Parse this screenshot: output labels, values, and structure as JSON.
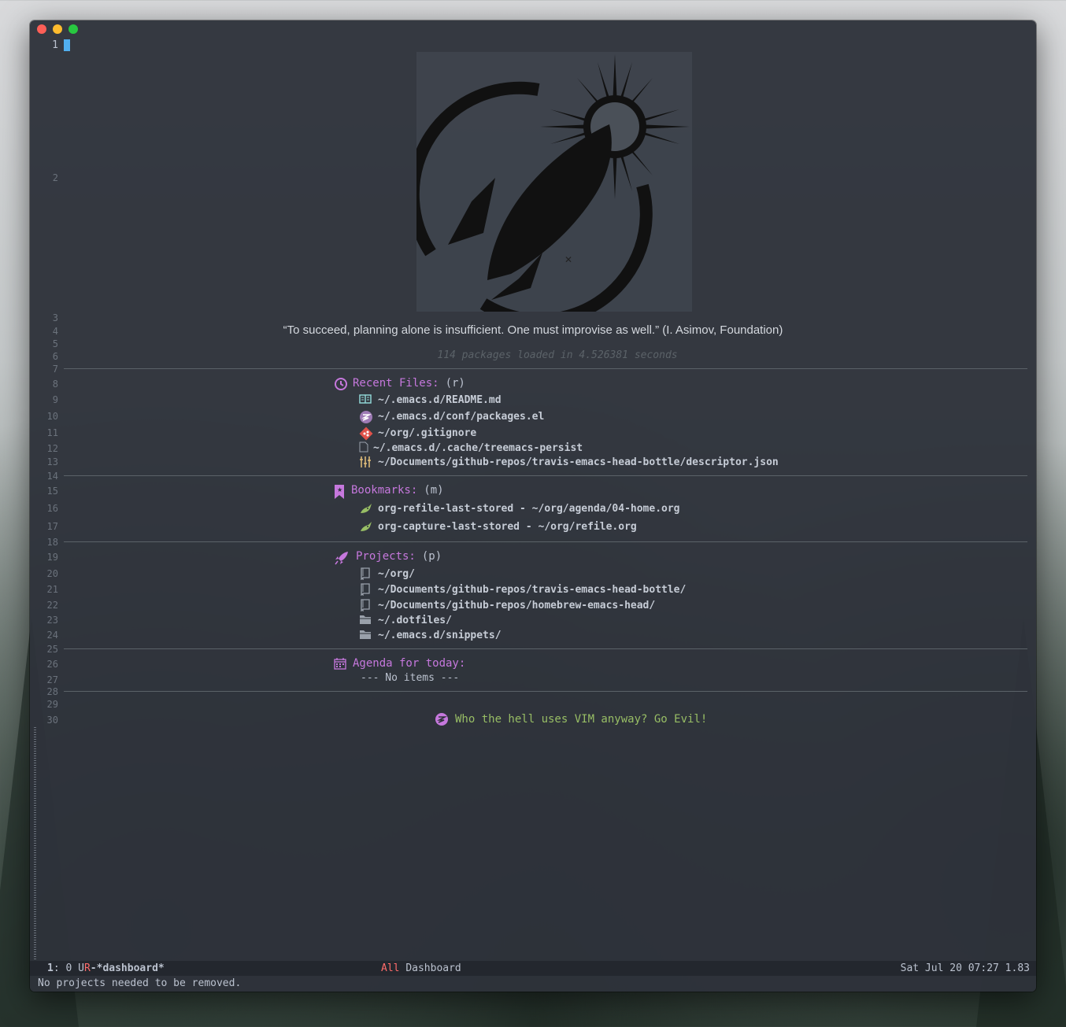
{
  "line_numbers": [
    "1",
    "2",
    "3",
    "4",
    "5",
    "6",
    "7",
    "8",
    "9",
    "10",
    "11",
    "12",
    "13",
    "14",
    "15",
    "16",
    "17",
    "18",
    "19",
    "20",
    "21",
    "22",
    "23",
    "24",
    "25",
    "26",
    "27",
    "28",
    "29",
    "30"
  ],
  "quote": "“To succeed, planning alone is insufficient. One must improvise as well.”  (I. Asimov, Foundation)",
  "loaded_text": "114 packages loaded in 4.526381 seconds",
  "recent_files": {
    "title": "Recent Files:",
    "key": "(r)",
    "icon": "history-icon",
    "items": [
      {
        "path": "~/.emacs.d/README.md",
        "icon": "book-icon"
      },
      {
        "path": "~/.emacs.d/conf/packages.el",
        "icon": "emacs-icon"
      },
      {
        "path": "~/org/.gitignore",
        "icon": "git-icon"
      },
      {
        "path": "~/.emacs.d/.cache/treemacs-persist",
        "icon": "file-icon"
      },
      {
        "path": "~/Documents/github-repos/travis-emacs-head-bottle/descriptor.json",
        "icon": "settings-icon"
      }
    ]
  },
  "bookmarks": {
    "title": "Bookmarks:",
    "key": "(m)",
    "icon": "bookmark-icon",
    "items": [
      {
        "label": "org-refile-last-stored - ~/org/agenda/04-home.org",
        "icon": "org-unicorn-icon"
      },
      {
        "label": "org-capture-last-stored - ~/org/refile.org",
        "icon": "org-unicorn-icon"
      }
    ]
  },
  "projects": {
    "title": "Projects:",
    "key": "(p)",
    "icon": "rocket-icon",
    "items": [
      {
        "path": "~/org/",
        "icon": "repo-icon"
      },
      {
        "path": "~/Documents/github-repos/travis-emacs-head-bottle/",
        "icon": "repo-icon"
      },
      {
        "path": "~/Documents/github-repos/homebrew-emacs-head/",
        "icon": "repo-icon"
      },
      {
        "path": "~/.dotfiles/",
        "icon": "folder-icon"
      },
      {
        "path": "~/.emacs.d/snippets/",
        "icon": "folder-icon"
      }
    ]
  },
  "agenda": {
    "title": "Agenda for today:",
    "icon": "calendar-icon",
    "empty": "--- No items ---"
  },
  "footer": "Who the hell uses VIM anyway? Go Evil!",
  "modeline": {
    "window_num": "1",
    "col": ": 0",
    "state_u": "U",
    "state_r": "R",
    "buffer": "-*dashboard*",
    "position": "All",
    "mode": "Dashboard",
    "datetime": "Sat Jul 20 07:27 1.83"
  },
  "echo": "No projects needed to be removed.",
  "colors": {
    "accent": "#c678dd",
    "green": "#98be65",
    "blue": "#51afef",
    "red": "#ff6c6b",
    "background": "#2e323a"
  }
}
